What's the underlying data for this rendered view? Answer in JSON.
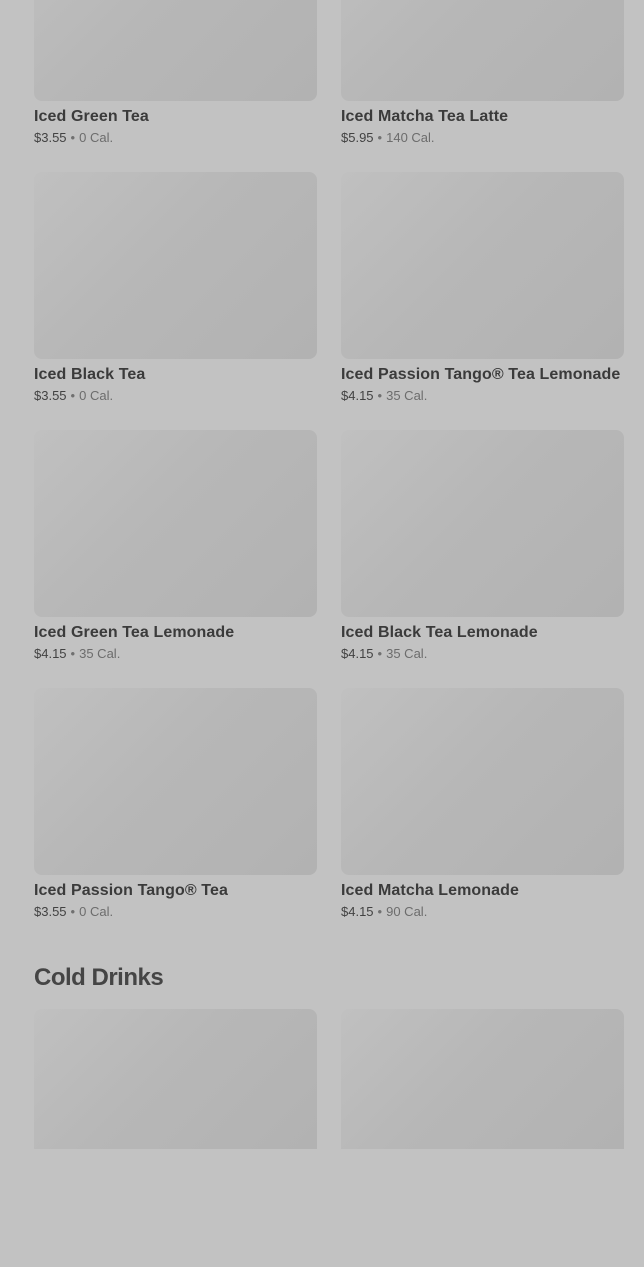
{
  "tea_items": [
    {
      "name": "Iced Green Tea",
      "price": "$3.55",
      "calories": "0 Cal."
    },
    {
      "name": "Iced Matcha Tea Latte",
      "price": "$5.95",
      "calories": "140 Cal."
    },
    {
      "name": "Iced Black Tea",
      "price": "$3.55",
      "calories": "0 Cal."
    },
    {
      "name": "Iced Passion Tango® Tea Lemonade",
      "price": "$4.15",
      "calories": "35 Cal."
    },
    {
      "name": "Iced Green Tea Lemonade",
      "price": "$4.15",
      "calories": "35 Cal."
    },
    {
      "name": "Iced Black Tea Lemonade",
      "price": "$4.15",
      "calories": "35 Cal."
    },
    {
      "name": "Iced Passion Tango® Tea",
      "price": "$3.55",
      "calories": "0 Cal."
    },
    {
      "name": "Iced Matcha Lemonade",
      "price": "$4.15",
      "calories": "90 Cal."
    }
  ],
  "separator": "•",
  "cold_section": {
    "title": "Cold Drinks"
  }
}
